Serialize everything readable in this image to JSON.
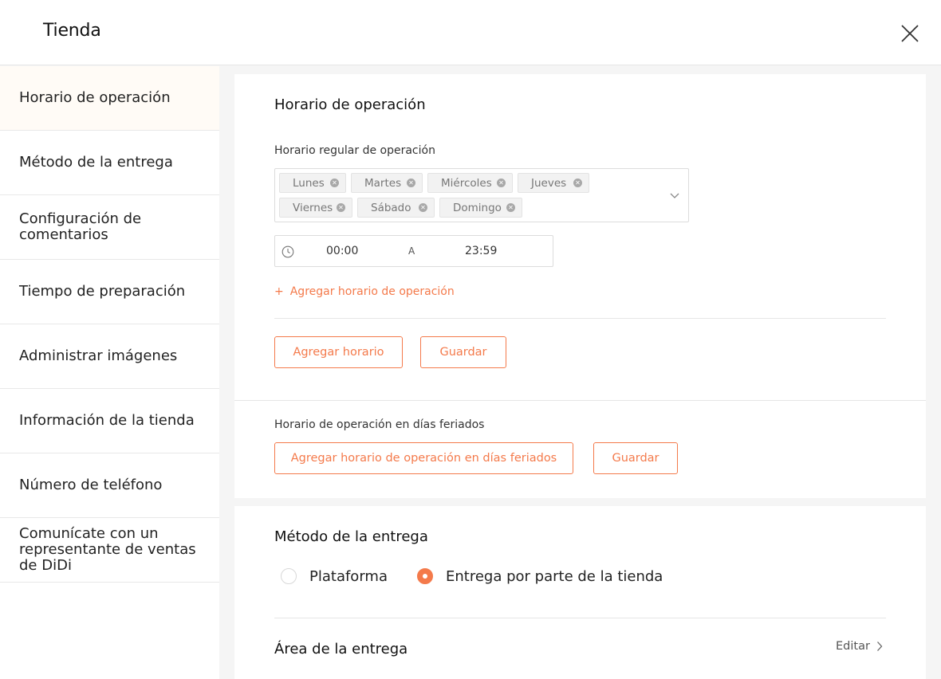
{
  "header": {
    "title": "Tienda"
  },
  "sidebar": {
    "items": [
      {
        "label": "Horario de operación"
      },
      {
        "label": "Método de la entrega"
      },
      {
        "label": "Configuración de comentarios"
      },
      {
        "label": "Tiempo de preparación"
      },
      {
        "label": "Administrar imágenes"
      },
      {
        "label": "Información de la tienda"
      },
      {
        "label": "Número de teléfono"
      },
      {
        "label": "Comunícate con un representante de ventas de DiDi"
      }
    ]
  },
  "operating_hours": {
    "title": "Horario de operación",
    "regular_label": "Horario regular de operación",
    "days": [
      "Lunes",
      "Martes",
      "Miércoles",
      "Jueves",
      "Viernes",
      "Sábado",
      "Domingo"
    ],
    "start_time": "00:00",
    "separator": "A",
    "end_time": "23:59",
    "add_hours_link": "Agregar horario de operación",
    "add_schedule_button": "Agregar horario",
    "save_button": "Guardar",
    "holiday_label": "Horario de operación en días feriados",
    "add_holiday_button": "Agregar horario de operación en días feriados",
    "holiday_save_button": "Guardar"
  },
  "delivery": {
    "title": "Método de la entrega",
    "options": [
      {
        "label": "Plataforma",
        "selected": false
      },
      {
        "label": "Entrega por parte de la tienda",
        "selected": true
      }
    ],
    "area_title": "Área de la entrega",
    "edit_link": "Editar"
  },
  "colors": {
    "accent": "#f47a4b",
    "active_bg": "#fffbf6"
  },
  "icons": [
    "close-icon",
    "chip-remove-icon",
    "chevron-down-icon",
    "clock-icon",
    "plus-icon",
    "chevron-right-icon"
  ]
}
